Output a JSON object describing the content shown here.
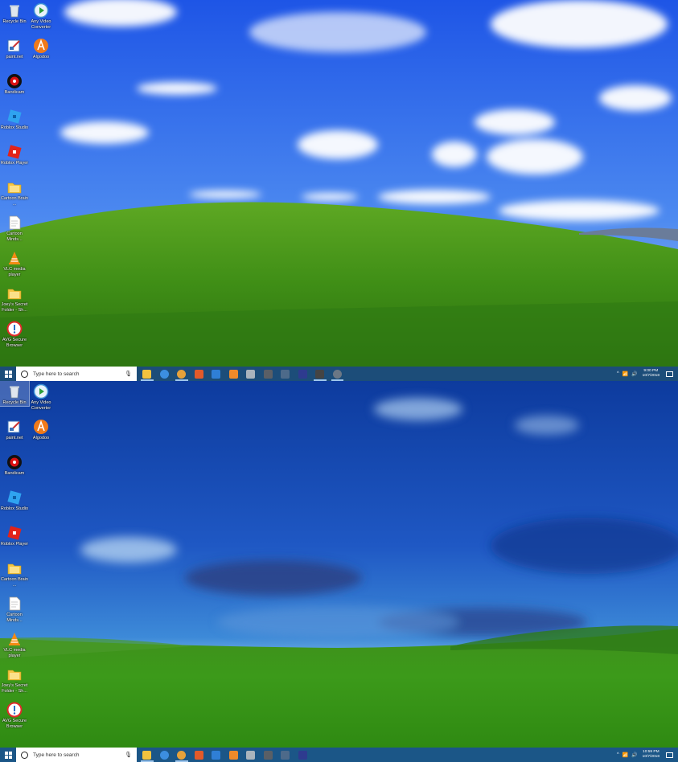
{
  "top": {
    "desktop_icons": [
      {
        "label": "Recycle Bin",
        "icon": "recycle-bin-icon"
      },
      {
        "label": "Any Video Converter",
        "icon": "video-converter-icon"
      },
      {
        "label": "paint.net",
        "icon": "paint-net-icon"
      },
      {
        "label": "Algodoo",
        "icon": "algodoo-icon"
      },
      {
        "label": "Bandicam",
        "icon": "bandicam-icon"
      },
      {
        "label": "Roblox Studio",
        "icon": "roblox-studio-icon"
      },
      {
        "label": "Roblox Player",
        "icon": "roblox-player-icon"
      },
      {
        "label": "Cartoon Brain ...",
        "icon": "folder-icon"
      },
      {
        "label": "Cartoon Minds...",
        "icon": "document-icon"
      },
      {
        "label": "VLC media player",
        "icon": "vlc-icon"
      },
      {
        "label": "Joey's Secret Folder - Sh...",
        "icon": "folder-icon"
      },
      {
        "label": "AVG Secure Browser",
        "icon": "avg-browser-icon"
      }
    ],
    "taskbar": {
      "search_placeholder": "Type here to search",
      "time": "9:00 PM",
      "date": "10/7/2018"
    }
  },
  "bottom": {
    "desktop_icons": [
      {
        "label": "Recycle Bin",
        "icon": "recycle-bin-icon"
      },
      {
        "label": "Any Video Converter",
        "icon": "video-converter-icon"
      },
      {
        "label": "paint.net",
        "icon": "paint-net-icon"
      },
      {
        "label": "Algodoo",
        "icon": "algodoo-icon"
      },
      {
        "label": "Bandicam",
        "icon": "bandicam-icon"
      },
      {
        "label": "Roblox Studio",
        "icon": "roblox-studio-icon"
      },
      {
        "label": "Roblox Player",
        "icon": "roblox-player-icon"
      },
      {
        "label": "Cartoon Brain ...",
        "icon": "folder-icon"
      },
      {
        "label": "Cartoon Minds...",
        "icon": "document-icon"
      },
      {
        "label": "VLC media player",
        "icon": "vlc-icon"
      },
      {
        "label": "Joey's Secret Folder - Sh...",
        "icon": "folder-icon"
      },
      {
        "label": "AVG Secure Browser",
        "icon": "avg-browser-icon"
      }
    ],
    "taskbar": {
      "search_placeholder": "Type here to search",
      "time": "10:59 PM",
      "date": "10/7/2018"
    }
  },
  "taskbar_apps_top": [
    "file-explorer-icon",
    "edge-icon",
    "chrome-icon",
    "office-icon",
    "photos-icon",
    "paint-icon",
    "dolphin-icon",
    "calculator-icon",
    "game-icon",
    "premiere-icon",
    "clapper-icon",
    "settings-icon"
  ],
  "taskbar_apps_bottom": [
    "file-explorer-icon",
    "edge-icon",
    "chrome-icon",
    "office-icon",
    "photos-icon",
    "paint-icon",
    "dolphin-icon",
    "calculator-icon",
    "game-icon",
    "premiere-icon"
  ],
  "colors": {
    "taskbar": "#1c4d79",
    "accent": "#9fc6ec"
  }
}
